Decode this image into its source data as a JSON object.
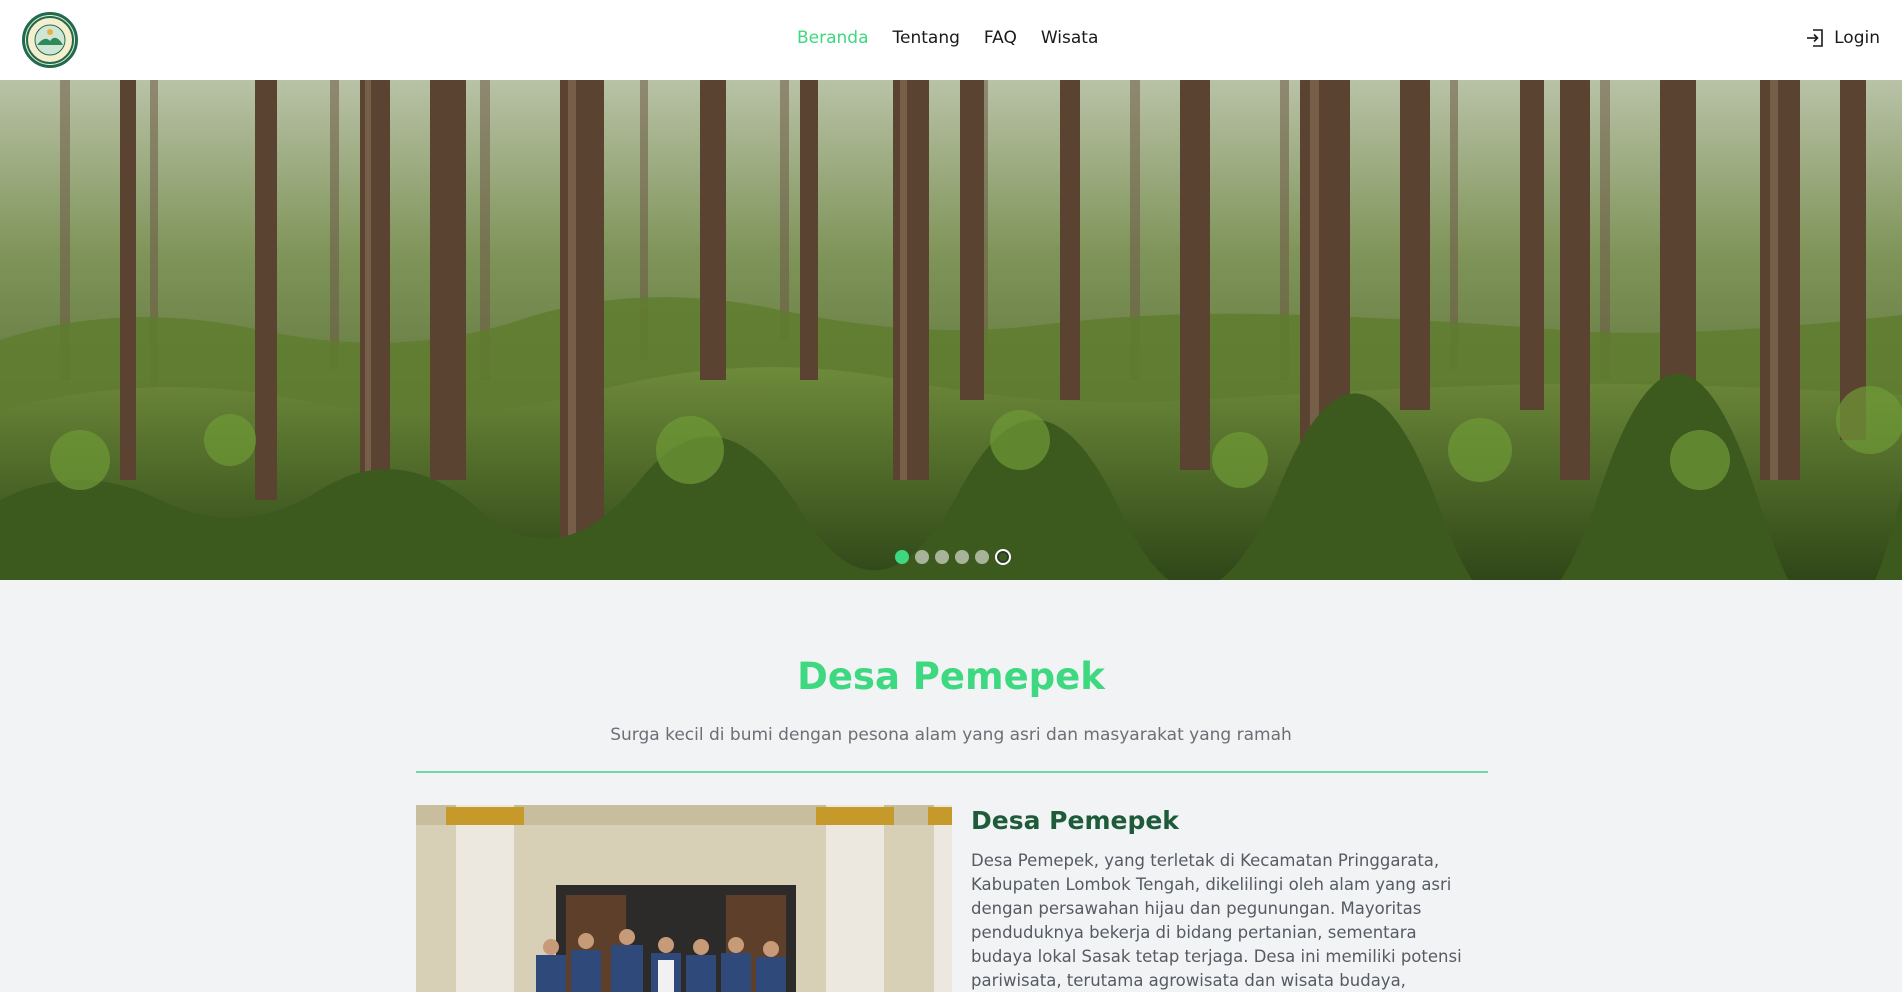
{
  "nav": {
    "logo_icon": "village-seal-logo-icon",
    "links": [
      {
        "label": "Beranda",
        "active": true
      },
      {
        "label": "Tentang",
        "active": false
      },
      {
        "label": "FAQ",
        "active": false
      },
      {
        "label": "Wisata",
        "active": false
      }
    ],
    "login_label": "Login",
    "login_icon": "login-arrow-icon",
    "active_color": "#3dd87f"
  },
  "hero": {
    "slide_count": 6,
    "active_slide": 1,
    "image_description_icon": "forest-photo"
  },
  "intro": {
    "title": "Desa Pemepek",
    "subtitle": "Surga kecil di bumi dengan pesona alam yang asri dan masyarakat yang ramah"
  },
  "about": {
    "heading": "Desa Pemepek",
    "text": "Desa Pemepek, yang terletak di Kecamatan Pringgarata, Kabupaten Lombok Tengah, dikelilingi oleh alam yang asri dengan persawahan hijau dan pegunungan. Mayoritas penduduknya bekerja di bidang pertanian, sementara budaya lokal Sasak tetap terjaga. Desa ini memiliki potensi pariwisata, terutama agrowisata dan wisata budaya, menawarkan"
  },
  "colors": {
    "accent": "#3dd87f",
    "heading_dark": "#1d5b3a",
    "background": "#f2f3f5"
  }
}
